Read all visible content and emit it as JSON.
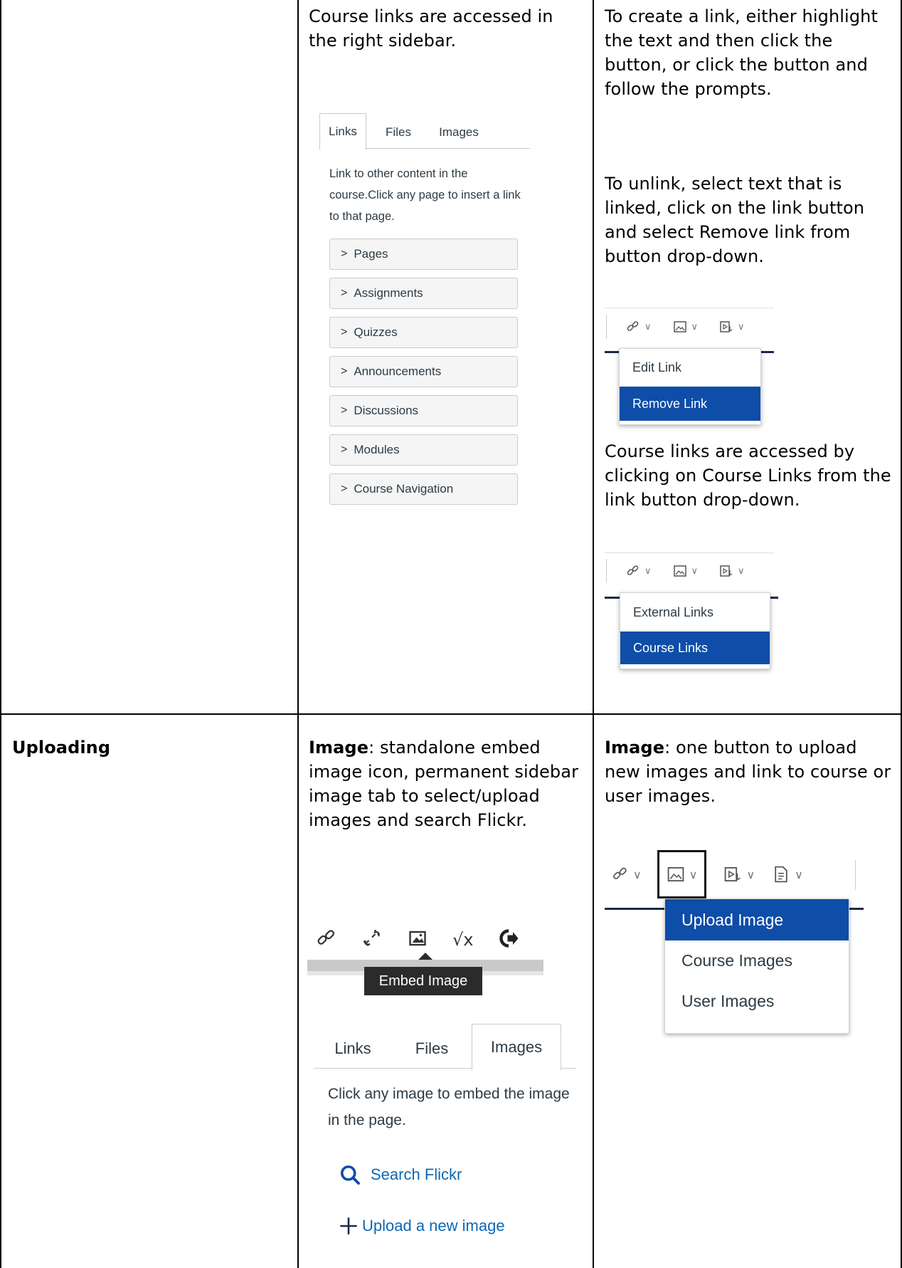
{
  "links_row": {
    "col2": {
      "text": "Course links are accessed in the right sidebar.",
      "sidebar": {
        "tabs": [
          "Links",
          "Files",
          "Images"
        ],
        "description": "Link to other content in the course.Click any page to insert a link to that page.",
        "items": [
          "Pages",
          "Assignments",
          "Quizzes",
          "Announcements",
          "Discussions",
          "Modules",
          "Course Navigation"
        ]
      }
    },
    "col3": {
      "text_create": "To create a link, either highlight the text and then click the button, or click the button and follow the prompts.",
      "text_unlink": "To unlink, select text that is linked, click on the link button and select Remove link from button drop-down.",
      "menu1": [
        "Edit Link",
        "Remove Link"
      ],
      "text_course_links": "Course links are accessed by clicking on Course Links from the link button drop-down.",
      "menu2": [
        "External Links",
        "Course Links"
      ]
    }
  },
  "uploading_row": {
    "col1": {
      "title": "Uploading"
    },
    "col2": {
      "label": "Image",
      "text": ": standalone embed image icon, permanent sidebar image tab to select/upload images and search Flickr.",
      "tooltip": "Embed Image",
      "sidebar": {
        "tabs": [
          "Links",
          "Files",
          "Images"
        ],
        "description": "Click any image to embed the image in the page.",
        "search": "Search Flickr",
        "upload": "Upload a new image"
      }
    },
    "col3": {
      "label": "Image",
      "text": ": one button to upload new images and link to course or user images.",
      "menu": [
        "Upload Image",
        "Course Images",
        "User Images"
      ]
    }
  },
  "colors": {
    "selected": "#0e4da8",
    "navy": "#1c2a4b",
    "link_blue": "#0e67b4"
  }
}
